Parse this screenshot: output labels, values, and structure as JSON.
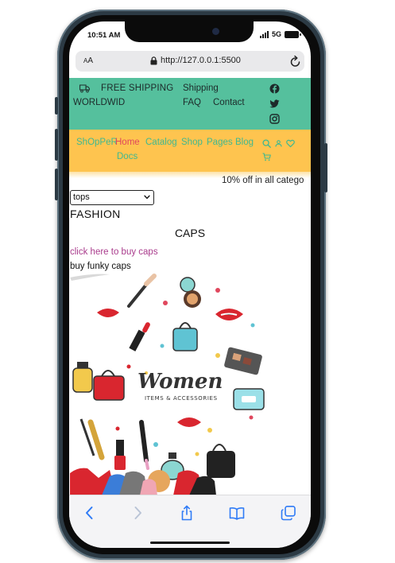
{
  "status": {
    "time": "10:51 AM",
    "network": "5G"
  },
  "browser": {
    "text_size_label_small": "A",
    "text_size_label_large": "A",
    "url": "http://127.0.0.1:5500"
  },
  "topbar": {
    "shipping_line1": "FREE SHIPPING",
    "shipping_line2": "WORLDWID",
    "links": {
      "shipping": "Shipping",
      "faq": "FAQ",
      "contact": "Contact"
    },
    "social": [
      "facebook-icon",
      "twitter-icon",
      "instagram-icon"
    ],
    "bg_color": "#55c09d"
  },
  "navbar": {
    "brand": "ShOpPeR",
    "links": {
      "home": "Home",
      "catalog": "Catalog",
      "shop": "Shop",
      "pages": "Pages",
      "blog": "Blog",
      "docs": "Docs"
    },
    "active": "Home",
    "icons": [
      "search-icon",
      "user-icon",
      "heart-icon",
      "cart-icon"
    ],
    "bg_color": "#fec44f",
    "link_color": "#3fb890",
    "active_color": "#e0475d"
  },
  "content": {
    "promo": "10% off in all catego",
    "select": {
      "selected": "tops"
    },
    "section_heading": "FASHION",
    "product_title": "CAPS",
    "product_link": "click here to buy caps",
    "product_desc": "buy funky caps",
    "image": {
      "headline": "Women",
      "subline": "ITEMS & ACCESSORIES"
    }
  }
}
